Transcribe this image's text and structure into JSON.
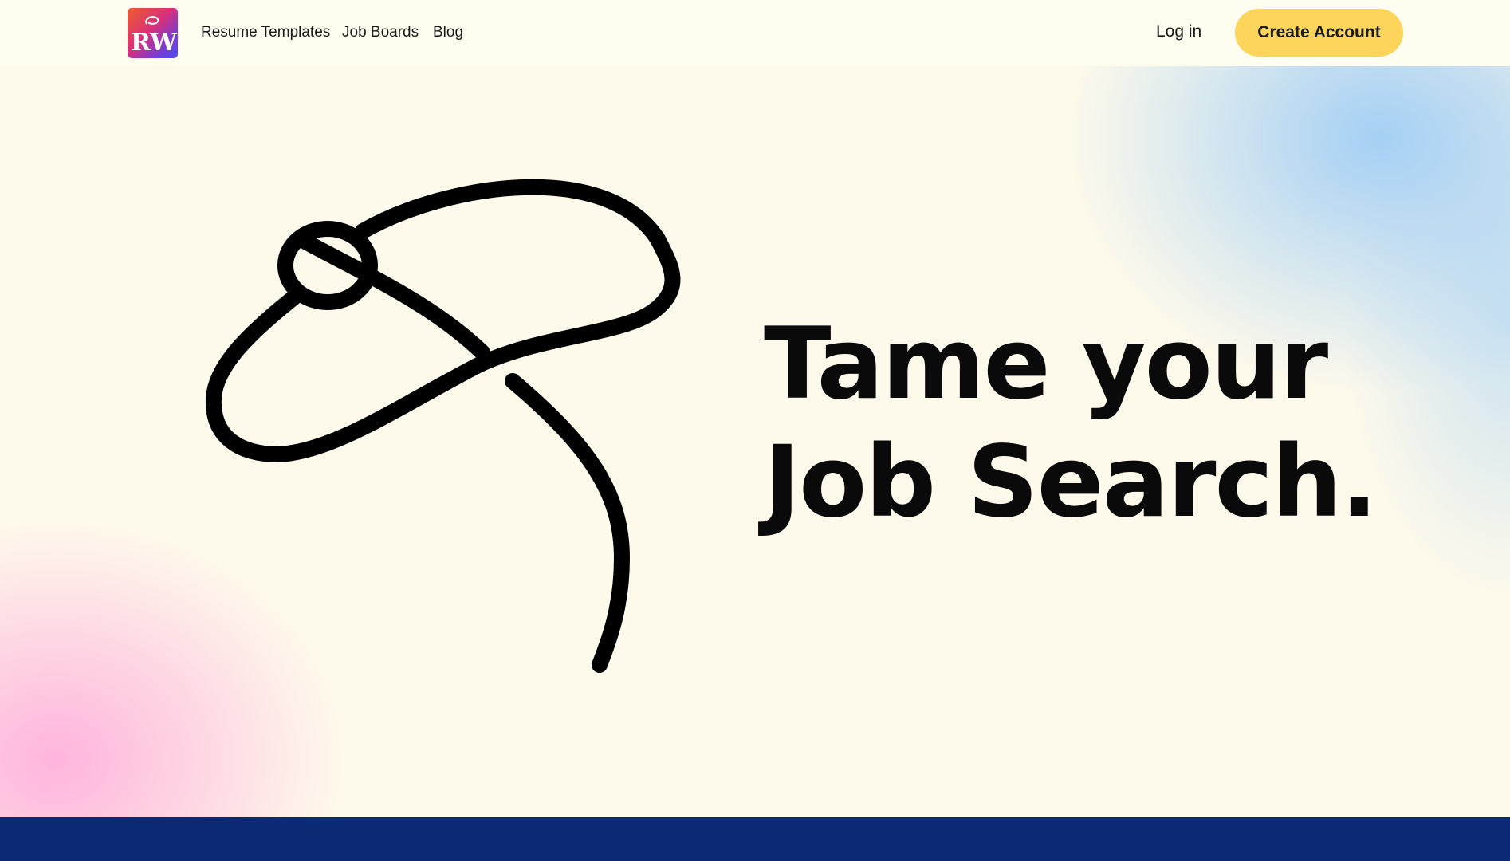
{
  "header": {
    "logo_text": "RW",
    "nav": [
      {
        "label": "Resume Templates"
      },
      {
        "label": "Job Boards"
      },
      {
        "label": "Blog"
      }
    ],
    "login_label": "Log in",
    "create_account_label": "Create Account"
  },
  "hero": {
    "headline_line1": "Tame your",
    "headline_line2": "Job Search."
  },
  "colors": {
    "background": "#fefdf0",
    "accent_button": "#fdd55a",
    "footer_band": "#0b2a73",
    "gradient_blue": "#a0cdf5",
    "gradient_pink": "#ffb0dc"
  },
  "icons": {
    "logo": "rw-logo-icon",
    "hero_art": "lasso-rope-icon"
  }
}
